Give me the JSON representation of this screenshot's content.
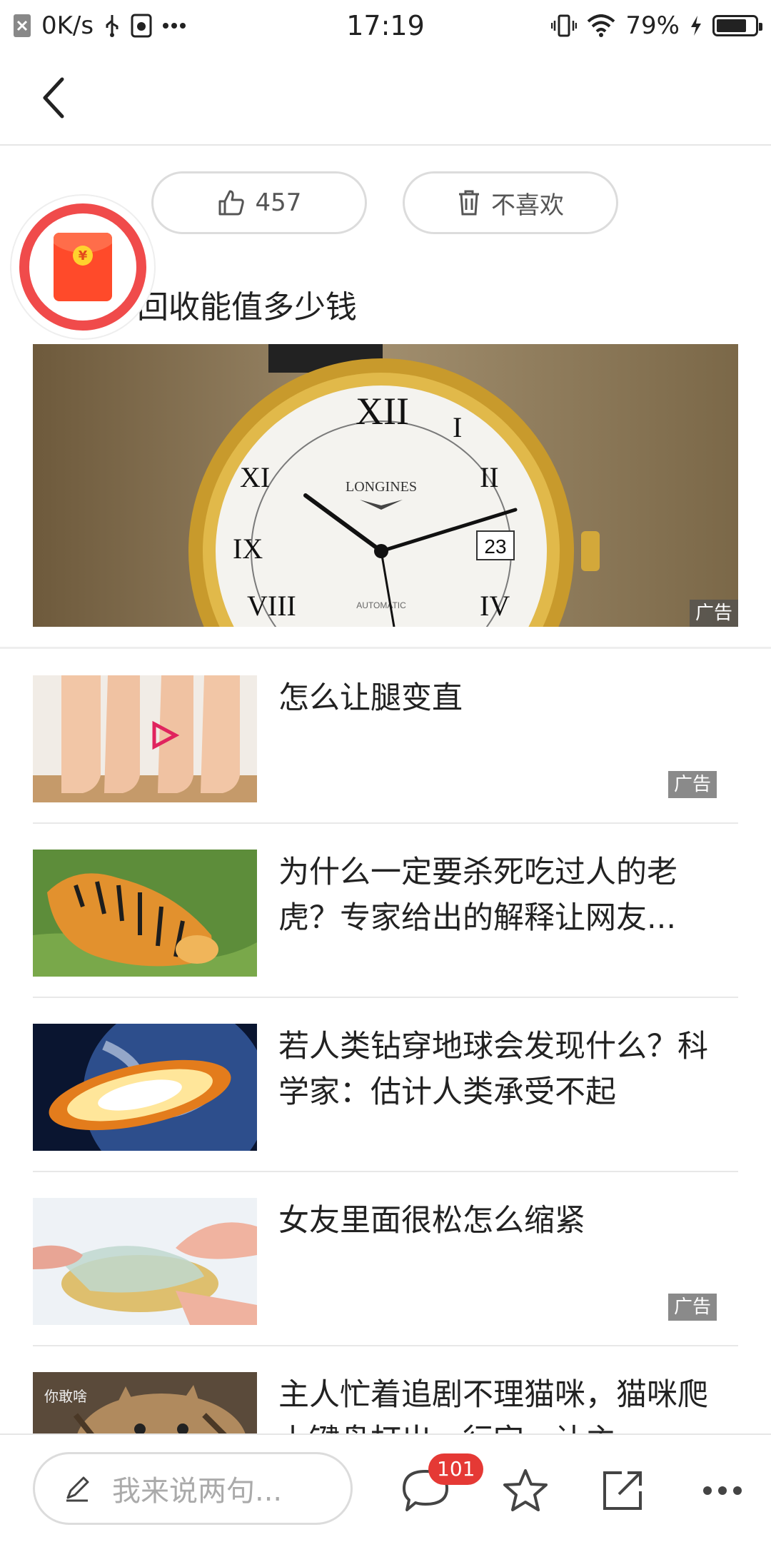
{
  "status_bar": {
    "speed": "0K/s",
    "time": "17:19",
    "battery": "79%",
    "battery_fraction": 0.79
  },
  "reactions": {
    "like_count": "457",
    "dislike_label": "不喜欢"
  },
  "ad_banner": {
    "title": "回收能值多少钱",
    "ad_label": "广告",
    "watch_brand": "LONGINES",
    "watch_date": "23",
    "watch_sub": "AUTOMATIC"
  },
  "feed": [
    {
      "title": "怎么让腿变直",
      "ad": "广告"
    },
    {
      "title": "为什么一定要杀死吃过人的老虎？专家给出的解释让网友...",
      "ad": ""
    },
    {
      "title": "若人类钻穿地球会发现什么？科学家：估计人类承受不起",
      "ad": ""
    },
    {
      "title": "女友里面很松怎么缩紧",
      "ad": "广告"
    },
    {
      "title": "主人忙着追剧不理猫咪，猫咪爬上键盘打出一行字，让主...",
      "ad": "",
      "thumb_caption": "你敢啥"
    }
  ],
  "bottom_bar": {
    "comment_placeholder": "我来说两句...",
    "comment_count": "101"
  },
  "colors": {
    "accent_red": "#e53935",
    "border_gray": "#dcdcdc"
  }
}
